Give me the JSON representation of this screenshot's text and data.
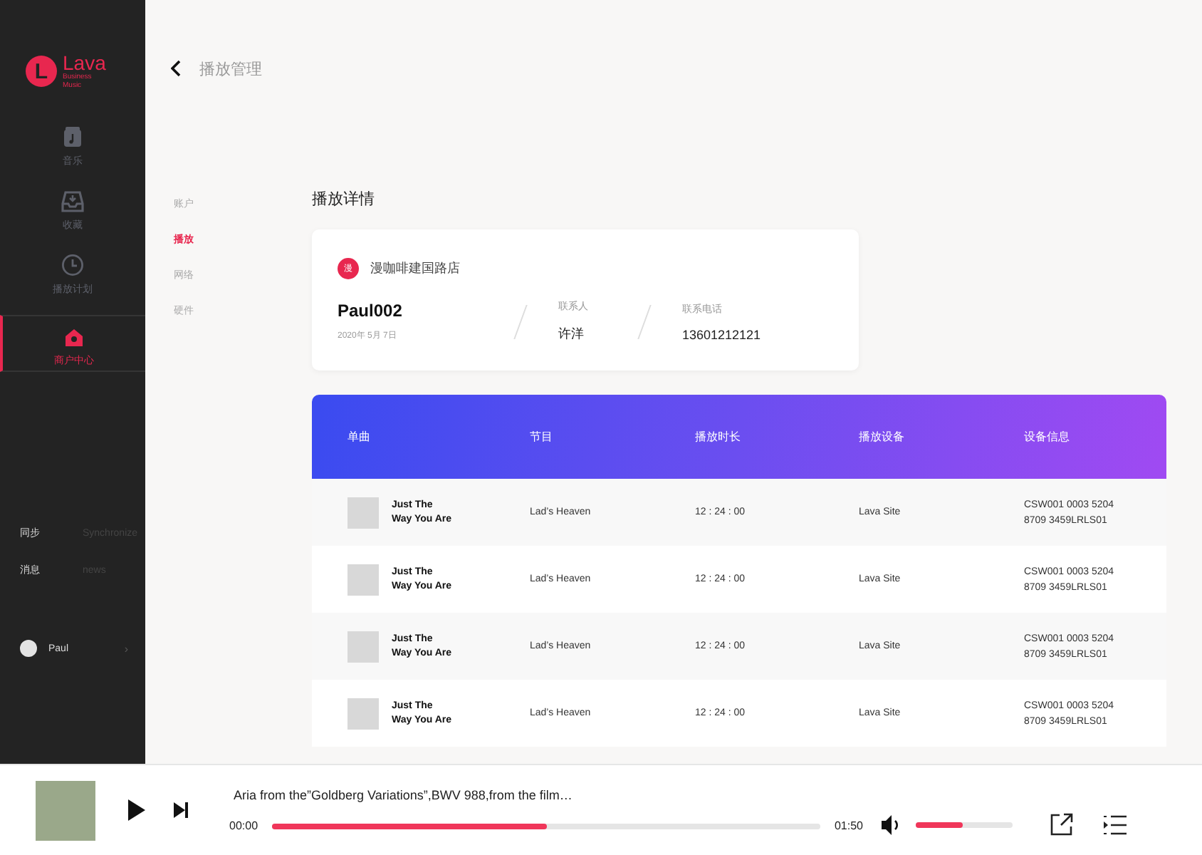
{
  "sidebar": {
    "logo": {
      "mark": "L",
      "name": "Lava",
      "tagline": "Business Music"
    },
    "items": [
      {
        "label": "音乐",
        "kind": "music",
        "selected": false
      },
      {
        "label": "收藏",
        "kind": "inbox",
        "selected": false
      },
      {
        "label": "播放计划",
        "kind": "clock",
        "selected": false
      },
      {
        "label": "商户中心",
        "kind": "shop",
        "selected": true
      }
    ],
    "links": [
      {
        "label": "同步",
        "hint": "Synchronize"
      },
      {
        "label": "消息",
        "hint": "news"
      }
    ],
    "user": {
      "name": "Paul",
      "arrow": "›"
    }
  },
  "header": {
    "title": "播放管理"
  },
  "subnav": [
    {
      "label": "账户",
      "selected": false
    },
    {
      "label": "播放",
      "selected": true
    },
    {
      "label": "网络",
      "selected": false
    },
    {
      "label": "硬件",
      "selected": false
    }
  ],
  "section_title": "播放详情",
  "store": {
    "badge": "漫",
    "name": "漫咖啡建国路店",
    "account": "Paul002",
    "date": "2020年 5月 7日",
    "fields": [
      {
        "label": "联系人",
        "value": "许洋"
      },
      {
        "label": "联系电话",
        "value": "13601212121"
      }
    ]
  },
  "table": {
    "columns": [
      "单曲",
      "节目",
      "播放时长",
      "播放设备",
      "设备信息"
    ],
    "rows": [
      {
        "song": "Just The Way You Are",
        "program": "Lad’s Heaven",
        "duration": "12 : 24 : 00",
        "device": "Lava Site",
        "info": "CSW001 0003 5204 8709 3459LRLS01"
      },
      {
        "song": "Just The Way You Are",
        "program": "Lad’s Heaven",
        "duration": "12 : 24 : 00",
        "device": "Lava Site",
        "info": "CSW001 0003 5204 8709 3459LRLS01"
      },
      {
        "song": "Just The Way You Are",
        "program": "Lad’s Heaven",
        "duration": "12 : 24 : 00",
        "device": "Lava Site",
        "info": "CSW001 0003 5204 8709 3459LRLS01"
      },
      {
        "song": "Just The Way You Are",
        "program": "Lad’s Heaven",
        "duration": "12 : 24 : 00",
        "device": "Lava Site",
        "info": "CSW001 0003 5204 8709 3459LRLS01"
      }
    ]
  },
  "player": {
    "track": "Aria from the”Goldberg Variations”,BWV 988,from the film…",
    "elapsed": "00:00",
    "total": "01:50",
    "progress": {
      "level": 0.5
    },
    "volume": {
      "level": 0.48
    }
  }
}
